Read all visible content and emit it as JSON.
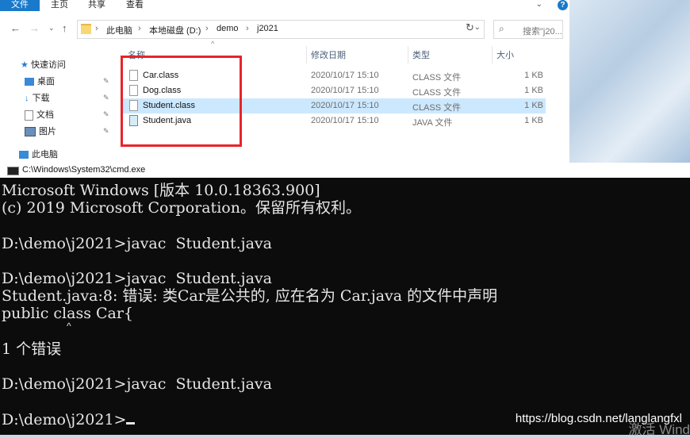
{
  "ribbon": {
    "file": "文件",
    "home": "主页",
    "share": "共享",
    "view": "查看"
  },
  "address": {
    "crumbs": [
      "此电脑",
      "本地磁盘 (D:)",
      "demo",
      "j2021"
    ],
    "search_placeholder": "搜索\"j20..."
  },
  "nav": {
    "quick_access": "快速访问",
    "items": [
      "桌面",
      "下载",
      "文档",
      "图片"
    ],
    "this_pc": "此电脑"
  },
  "columns": {
    "name": "名称",
    "date": "修改日期",
    "type": "类型",
    "size": "大小"
  },
  "files": [
    {
      "name": "Car.class",
      "date": "2020/10/17 15:10",
      "type": "CLASS 文件",
      "size": "1 KB"
    },
    {
      "name": "Dog.class",
      "date": "2020/10/17 15:10",
      "type": "CLASS 文件",
      "size": "1 KB"
    },
    {
      "name": "Student.class",
      "date": "2020/10/17 15:10",
      "type": "CLASS 文件",
      "size": "1 KB"
    },
    {
      "name": "Student.java",
      "date": "2020/10/17 15:10",
      "type": "JAVA 文件",
      "size": "1 KB"
    }
  ],
  "cmd": {
    "title": "C:\\Windows\\System32\\cmd.exe",
    "lines": [
      "Microsoft Windows [版本 10.0.18363.900]",
      "(c) 2019 Microsoft Corporation。保留所有权利。",
      "",
      "D:\\demo\\j2021>javac  Student.java",
      "",
      "D:\\demo\\j2021>javac  Student.java",
      "Student.java:8: 错误: 类Car是公共的, 应在名为 Car.java 的文件中声明",
      "public class Car{",
      "",
      "1 个错误",
      "",
      "D:\\demo\\j2021>javac  Student.java",
      ""
    ],
    "prompt": "D:\\demo\\j2021>",
    "caret": "^"
  },
  "watermark": "https://blog.csdn.net/langlangfxl",
  "activate": "激活 Wind"
}
